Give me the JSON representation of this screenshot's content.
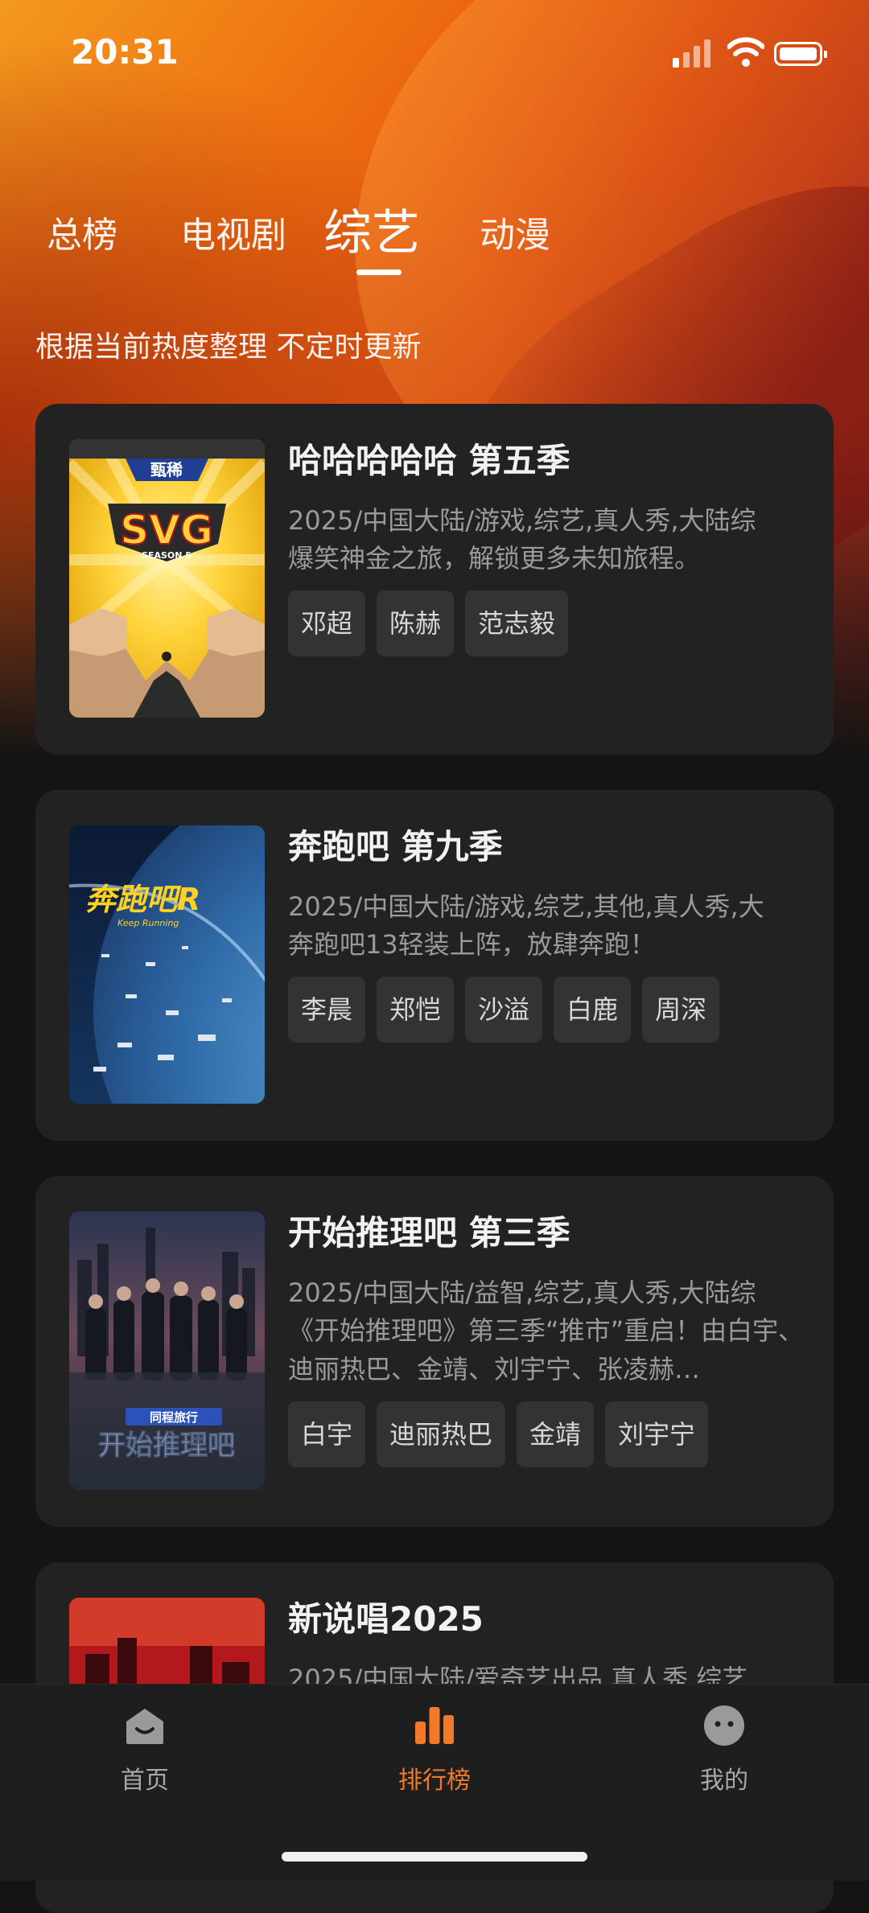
{
  "status_bar": {
    "time": "20:31"
  },
  "top_tabs": [
    {
      "label": "总榜",
      "active": false
    },
    {
      "label": "电视剧",
      "active": false
    },
    {
      "label": "综艺",
      "active": true
    },
    {
      "label": "动漫",
      "active": false
    }
  ],
  "subtitle": "根据当前热度整理 不定时更新",
  "items": [
    {
      "title": "哈哈哈哈哈 第五季",
      "meta": "2025/中国大陆/游戏,综艺,真人秀,大陆综",
      "desc": "爆笑神金之旅，解锁更多未知旅程。",
      "tags": [
        "邓超",
        "陈赫",
        "范志毅"
      ],
      "poster_texts": [
        "甄稀",
        "SVG",
        "SEASON 5"
      ]
    },
    {
      "title": "奔跑吧 第九季",
      "meta": "2025/中国大陆/游戏,综艺,其他,真人秀,大",
      "desc": "奔跑吧13轻装上阵，放肆奔跑！",
      "tags": [
        "李晨",
        "郑恺",
        "沙溢",
        "白鹿",
        "周深"
      ],
      "poster_texts": [
        "奔跑吧R",
        "Keep Running"
      ]
    },
    {
      "title": "开始推理吧 第三季",
      "meta": "2025/中国大陆/益智,综艺,真人秀,大陆综",
      "desc": "《开始推理吧》第三季“推市”重启！由白宇、迪丽热巴、金靖、刘宇宁、张凌赫…",
      "tags": [
        "白宇",
        "迪丽热巴",
        "金靖",
        "刘宇宁"
      ],
      "poster_texts": [
        "同程旅行",
        "开始推理吧"
      ]
    },
    {
      "title": "新说唱2025",
      "meta": "2025/中国大陆/爱奇艺出品,真人秀,综艺",
      "desc": "",
      "tags": [],
      "poster_texts": []
    }
  ],
  "bottom_nav": [
    {
      "label": "首页",
      "icon": "home-icon",
      "active": false
    },
    {
      "label": "排行榜",
      "icon": "ranking-chart-icon",
      "active": true
    },
    {
      "label": "我的",
      "icon": "profile-icon",
      "active": false
    }
  ],
  "colors": {
    "accent": "#f07a2a",
    "card": "#222222",
    "tag": "#333333",
    "background": "#141414"
  }
}
